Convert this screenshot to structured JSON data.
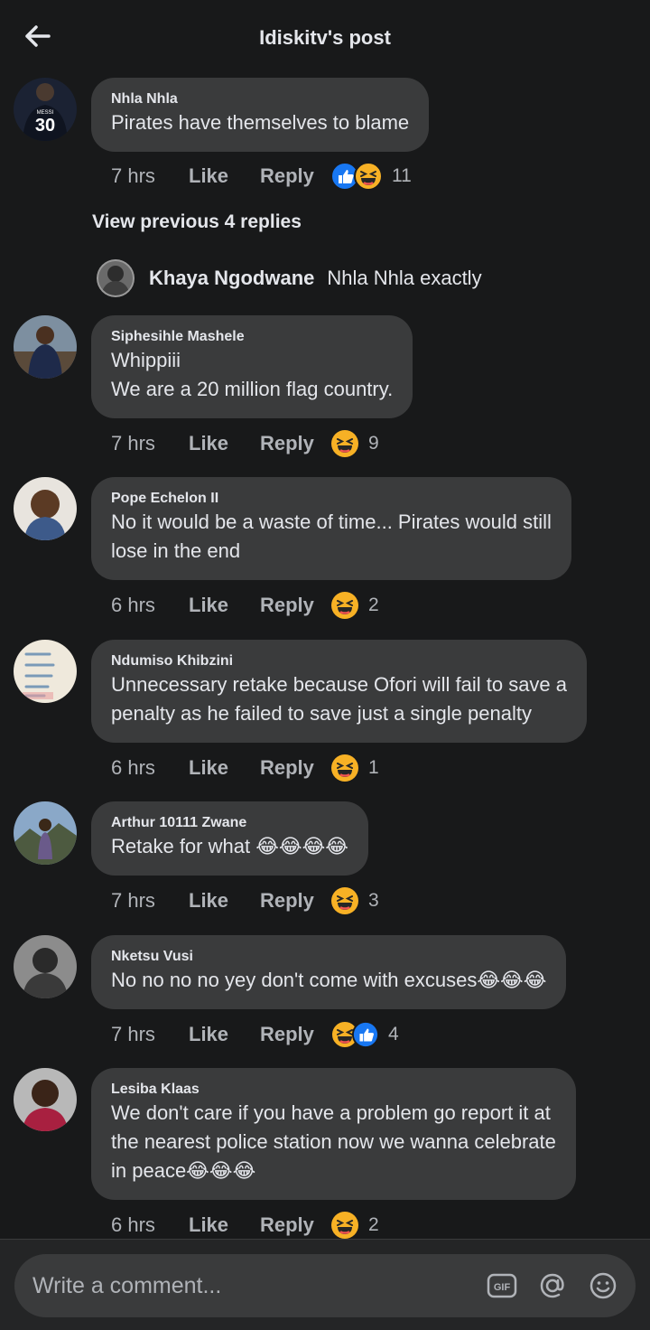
{
  "header": {
    "title": "Idiskitv's post",
    "back_icon": "back-arrow-icon"
  },
  "comments": [
    {
      "author": "Nhla Nhla",
      "text": "Pirates have themselves to blame",
      "time": "7 hrs",
      "like": "Like",
      "reply": "Reply",
      "reactions": [
        "like",
        "haha"
      ],
      "count": "11",
      "avatar_text": "30"
    },
    {
      "author": "Siphesihle Mashele",
      "text": "Whippiii\nWe are a 20 million flag country.",
      "time": "7 hrs",
      "like": "Like",
      "reply": "Reply",
      "reactions": [
        "haha"
      ],
      "count": "9"
    },
    {
      "author": "Pope Echelon II",
      "text": "No it would be a waste of time... Pirates would still\nlose in the end",
      "time": "6 hrs",
      "like": "Like",
      "reply": "Reply",
      "reactions": [
        "haha"
      ],
      "count": "2"
    },
    {
      "author": "Ndumiso Khibzini",
      "text": "Unnecessary retake because Ofori will  fail to save a\npenalty as he failed to save just a single penalty",
      "time": "6 hrs",
      "like": "Like",
      "reply": "Reply",
      "reactions": [
        "haha"
      ],
      "count": "1"
    },
    {
      "author": "Arthur 10111 Zwane",
      "text": "Retake for what 😂😂😂😂",
      "time": "7 hrs",
      "like": "Like",
      "reply": "Reply",
      "reactions": [
        "haha"
      ],
      "count": "3"
    },
    {
      "author": "Nketsu Vusi",
      "text": "No no no no yey don't come with excuses😂😂😂",
      "time": "7 hrs",
      "like": "Like",
      "reply": "Reply",
      "reactions": [
        "haha",
        "like"
      ],
      "count": "4"
    },
    {
      "author": "Lesiba Klaas",
      "text": "We don't care if you have a problem go report it at\nthe nearest police station now we wanna celebrate\nin peace😂😂😂",
      "time": "6 hrs",
      "like": "Like",
      "reply": "Reply",
      "reactions": [
        "haha"
      ],
      "count": "2"
    }
  ],
  "view_previous": "View previous 4 replies",
  "nested_reply": {
    "author": "Khaya Ngodwane",
    "text": "Nhla Nhla exactly"
  },
  "composer": {
    "placeholder": "Write a comment...",
    "icons": [
      "gif-icon",
      "at-icon",
      "emoji-icon"
    ],
    "gif_label": "GIF"
  },
  "colors": {
    "background": "#18191a",
    "bubble": "#3a3b3c",
    "text": "#e4e6eb",
    "muted": "#b0b3b8",
    "like_blue": "#1877f2",
    "haha_yellow": "#f7b125"
  }
}
